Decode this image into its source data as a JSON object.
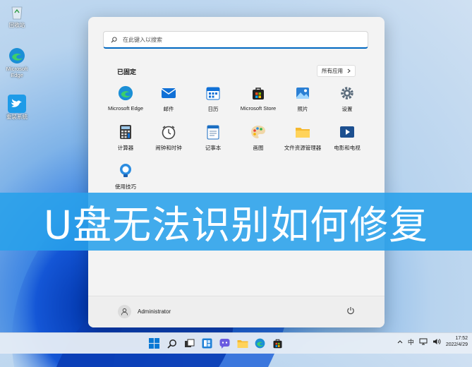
{
  "desktop": {
    "icons": [
      {
        "label": "回收站",
        "icon": "recycle-bin-icon"
      },
      {
        "label": "Microsoft Edge",
        "icon": "edge-icon"
      },
      {
        "label": "重装系统",
        "icon": "bird-icon"
      }
    ]
  },
  "start_menu": {
    "search_placeholder": "在此键入以搜索",
    "pinned_title": "已固定",
    "all_apps_label": "所有应用",
    "apps": [
      {
        "label": "Microsoft Edge",
        "icon": "edge-icon"
      },
      {
        "label": "邮件",
        "icon": "mail-icon"
      },
      {
        "label": "日历",
        "icon": "calendar-icon"
      },
      {
        "label": "Microsoft Store",
        "icon": "store-icon"
      },
      {
        "label": "照片",
        "icon": "photos-icon"
      },
      {
        "label": "设置",
        "icon": "settings-gear-icon"
      },
      {
        "label": "计算器",
        "icon": "calculator-icon"
      },
      {
        "label": "闹钟和时钟",
        "icon": "alarm-clock-icon"
      },
      {
        "label": "记事本",
        "icon": "notepad-icon"
      },
      {
        "label": "画图",
        "icon": "paint-palette-icon"
      },
      {
        "label": "文件资源管理器",
        "icon": "folder-icon"
      },
      {
        "label": "电影和电视",
        "icon": "movies-tv-icon"
      },
      {
        "label": "使用技巧",
        "icon": "tips-bulb-icon"
      }
    ],
    "user_name": "Administrator"
  },
  "banner": {
    "text": "U盘无法识别如何修复"
  },
  "taskbar": {
    "language": "中",
    "time": "17:52",
    "date": "2022/4/29"
  },
  "colors": {
    "accent": "#0067c0",
    "banner": "#28a0eb"
  }
}
